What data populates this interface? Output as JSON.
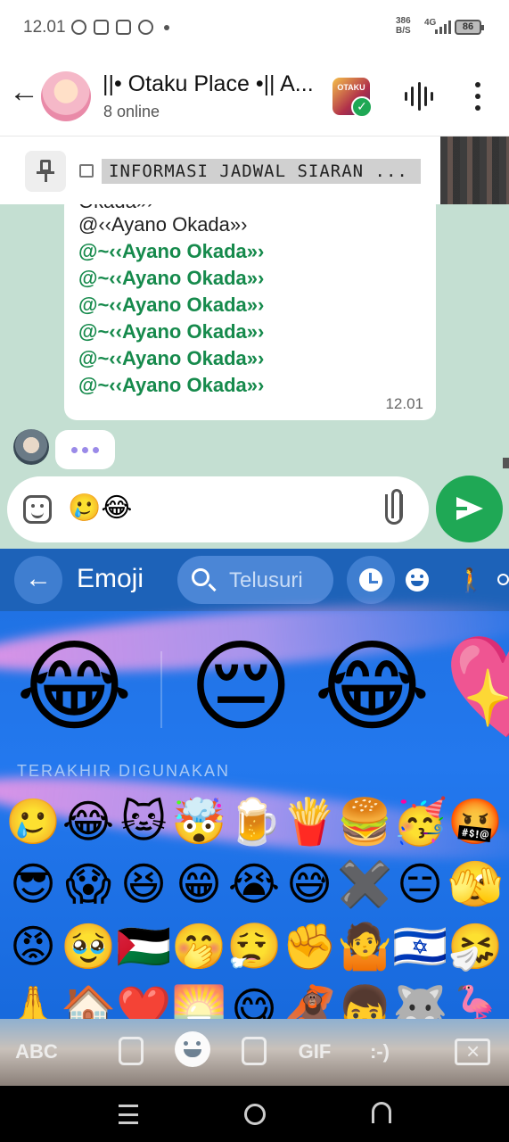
{
  "status_bar": {
    "time": "12.01",
    "net_speed_value": "386",
    "net_speed_unit": "B/S",
    "network": "4G",
    "battery": "86"
  },
  "header": {
    "group_name": "||• Otaku Place •|| A...",
    "online_status": "8 online",
    "community_badge": "OTAKU"
  },
  "pinned": {
    "text": "INFORMASI JADWAL SIARAN ..."
  },
  "message": {
    "lines": [
      "Okada»›",
      "@‹‹Ayano Okada»›",
      "@~‹‹Ayano Okada»›",
      "@~‹‹Ayano Okada»›",
      "@~‹‹Ayano Okada»›",
      "@~‹‹Ayano Okada»›",
      "@~‹‹Ayano Okada»›",
      "@~‹‹Ayano Okada»›"
    ],
    "time": "12.01"
  },
  "typing_indicator": "•••",
  "composer": {
    "text": "🥲😂"
  },
  "emoji_keyboard": {
    "back_label": "←",
    "title": "Emoji",
    "search_placeholder": "Telusuri",
    "category_icons": [
      "clock-icon",
      "smiley-icon",
      "person-icon",
      "more-icon"
    ],
    "featured": [
      "😂",
      "😔",
      "😂",
      "💖"
    ],
    "section_label": "TERAKHIR DIGUNAKAN",
    "recent": [
      [
        "🥲",
        "😂",
        "🐱",
        "🤯",
        "🍺",
        "🍟",
        "🍔",
        "🥳",
        "🤬"
      ],
      [
        "😎",
        "😱",
        "😆",
        "😁",
        "😭",
        "😅",
        "✖️",
        "😑",
        "🫣"
      ],
      [
        "😡",
        "🥹",
        "🇵🇸",
        "🤭",
        "😮‍💨",
        "✊",
        "🤷",
        "🇮🇱",
        "🤧"
      ],
      [
        "🙏",
        "🏠",
        "❤️",
        "🌅",
        "😋",
        "🦧",
        "👦",
        "🐺",
        "🦩"
      ]
    ],
    "bottom_keys": {
      "abc": "ABC",
      "gif": "GIF",
      "emoticon": ":-)"
    }
  }
}
